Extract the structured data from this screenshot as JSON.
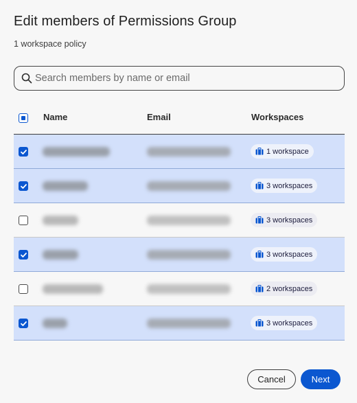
{
  "dialog": {
    "title": "Edit members of Permissions Group",
    "subtitle": "1 workspace policy"
  },
  "search": {
    "placeholder": "Search members by name or email"
  },
  "table": {
    "columns": {
      "name": "Name",
      "email": "Email",
      "workspaces": "Workspaces"
    },
    "select_all_state": "indeterminate",
    "rows": [
      {
        "selected": true,
        "workspaces": "1 workspace"
      },
      {
        "selected": true,
        "workspaces": "3 workspaces"
      },
      {
        "selected": false,
        "workspaces": "3 workspaces"
      },
      {
        "selected": true,
        "workspaces": "3 workspaces"
      },
      {
        "selected": false,
        "workspaces": "2 workspaces"
      },
      {
        "selected": true,
        "workspaces": "3 workspaces"
      }
    ]
  },
  "footer": {
    "cancel_label": "Cancel",
    "next_label": "Next"
  },
  "colors": {
    "accent": "#0b57d0",
    "selected_row": "#d3e0fb"
  },
  "icons": {
    "search": "search-icon",
    "workspace": "briefcase-icon",
    "checkbox": "checkmark-icon"
  }
}
